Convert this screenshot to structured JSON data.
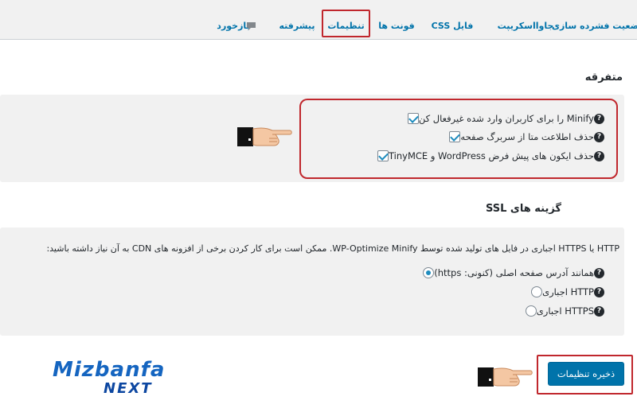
{
  "tabs": [
    {
      "label": "وضعیت فشرده سازی"
    },
    {
      "label": "جاوااسکریپت"
    },
    {
      "label": "فایل CSS"
    },
    {
      "label": "فونت ها"
    },
    {
      "label": "تنظیمات"
    },
    {
      "label": "پیشرفته"
    },
    {
      "label": "بازخورد"
    }
  ],
  "misc": {
    "title": "متفرقه",
    "options": [
      {
        "label": "Minify را برای کاربران وارد شده غیرفعال کن",
        "checked": true
      },
      {
        "label": "حذف اطلاعت متا از سربرگ صفحه",
        "checked": true
      },
      {
        "label": "حذف ایکون های پیش فرض WordPress و TinyMCE",
        "checked": true
      }
    ]
  },
  "ssl": {
    "title": "گزینه های SSL",
    "description": "HTTP یا HTTPS اجباری در فایل های تولید شده توسط WP-Optimize Minify. ممکن است برای کار کردن برخی از افزونه های CDN به آن نیاز داشته باشید:",
    "options": [
      {
        "label": "همانند آدرس صفحه اصلی (کنونی: https)",
        "selected": true
      },
      {
        "label": "HTTP اجباری",
        "selected": false
      },
      {
        "label": "HTTPS اجباری",
        "selected": false
      }
    ]
  },
  "save_label": "ذخیره تنظیمات",
  "logo": {
    "top": "Mizbanfa",
    "bottom": "NEXT"
  },
  "colors": {
    "accent": "#0073aa",
    "highlight": "#c0272d"
  }
}
